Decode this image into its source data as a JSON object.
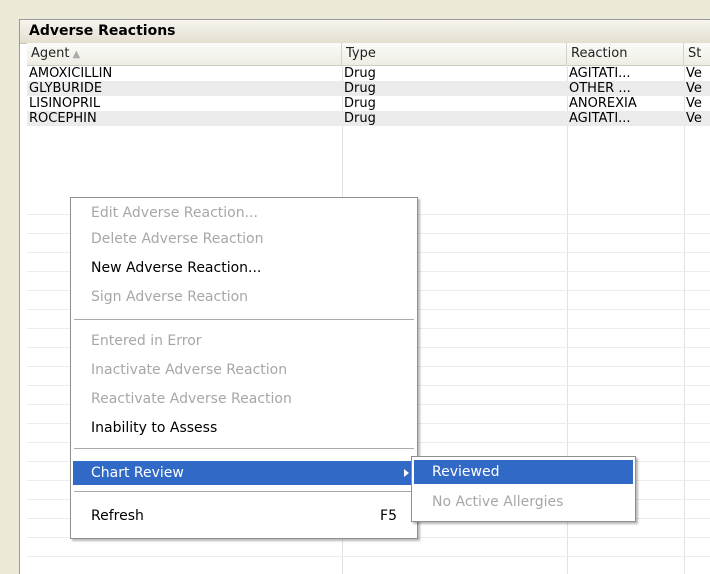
{
  "panel": {
    "title": "Adverse Reactions"
  },
  "table": {
    "columns": [
      {
        "label": "Agent",
        "sort": "ascending"
      },
      {
        "label": "Type"
      },
      {
        "label": "Reaction"
      },
      {
        "label": "St"
      }
    ],
    "rows": [
      {
        "agent": "AMOXICILLIN",
        "type": "Drug",
        "reaction": "AGITATI...",
        "status": "Ve"
      },
      {
        "agent": "GLYBURIDE",
        "type": "Drug",
        "reaction": "OTHER ...",
        "status": "Ve"
      },
      {
        "agent": "LISINOPRIL",
        "type": "Drug",
        "reaction": "ANOREXIA",
        "status": "Ve"
      },
      {
        "agent": "ROCEPHIN",
        "type": "Drug",
        "reaction": "AGITATI...",
        "status": "Ve"
      }
    ]
  },
  "context_menu": {
    "items": [
      {
        "label": "Edit Adverse Reaction...",
        "enabled": false
      },
      {
        "label": "Delete Adverse Reaction",
        "enabled": false
      },
      {
        "label": "New Adverse Reaction...",
        "enabled": true
      },
      {
        "label": "Sign Adverse Reaction",
        "enabled": false
      },
      {
        "label": "Entered in Error",
        "enabled": false
      },
      {
        "label": "Inactivate Adverse Reaction",
        "enabled": false
      },
      {
        "label": "Reactivate Adverse Reaction",
        "enabled": false
      },
      {
        "label": "Inability to Assess",
        "enabled": true
      },
      {
        "label": "Chart Review",
        "enabled": true,
        "highlighted": true
      },
      {
        "label": "Refresh",
        "enabled": true,
        "shortcut": "F5"
      }
    ]
  },
  "submenu": {
    "items": [
      {
        "label": "Reviewed",
        "enabled": true,
        "highlighted": true
      },
      {
        "label": "No Active Allergies",
        "enabled": false
      }
    ]
  },
  "colors": {
    "highlight": "#3169c6",
    "disabled_text": "#a7a6aa",
    "alt_row": "#ebebeb"
  }
}
